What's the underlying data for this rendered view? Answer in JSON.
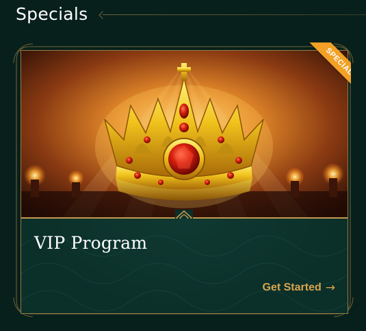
{
  "section": {
    "title": "Specials"
  },
  "card": {
    "title": "VIP Program",
    "cta_label": "Get Started",
    "cta_arrow": "→",
    "badge": "SPECIAL",
    "image_subject": "jeweled-gold-crown"
  },
  "colors": {
    "page_bg": "#08201b",
    "card_bg": "#0b2f29",
    "gold_accent": "#c49a50",
    "cta_color": "#d9a54f",
    "badge_color": "#f2a126"
  }
}
